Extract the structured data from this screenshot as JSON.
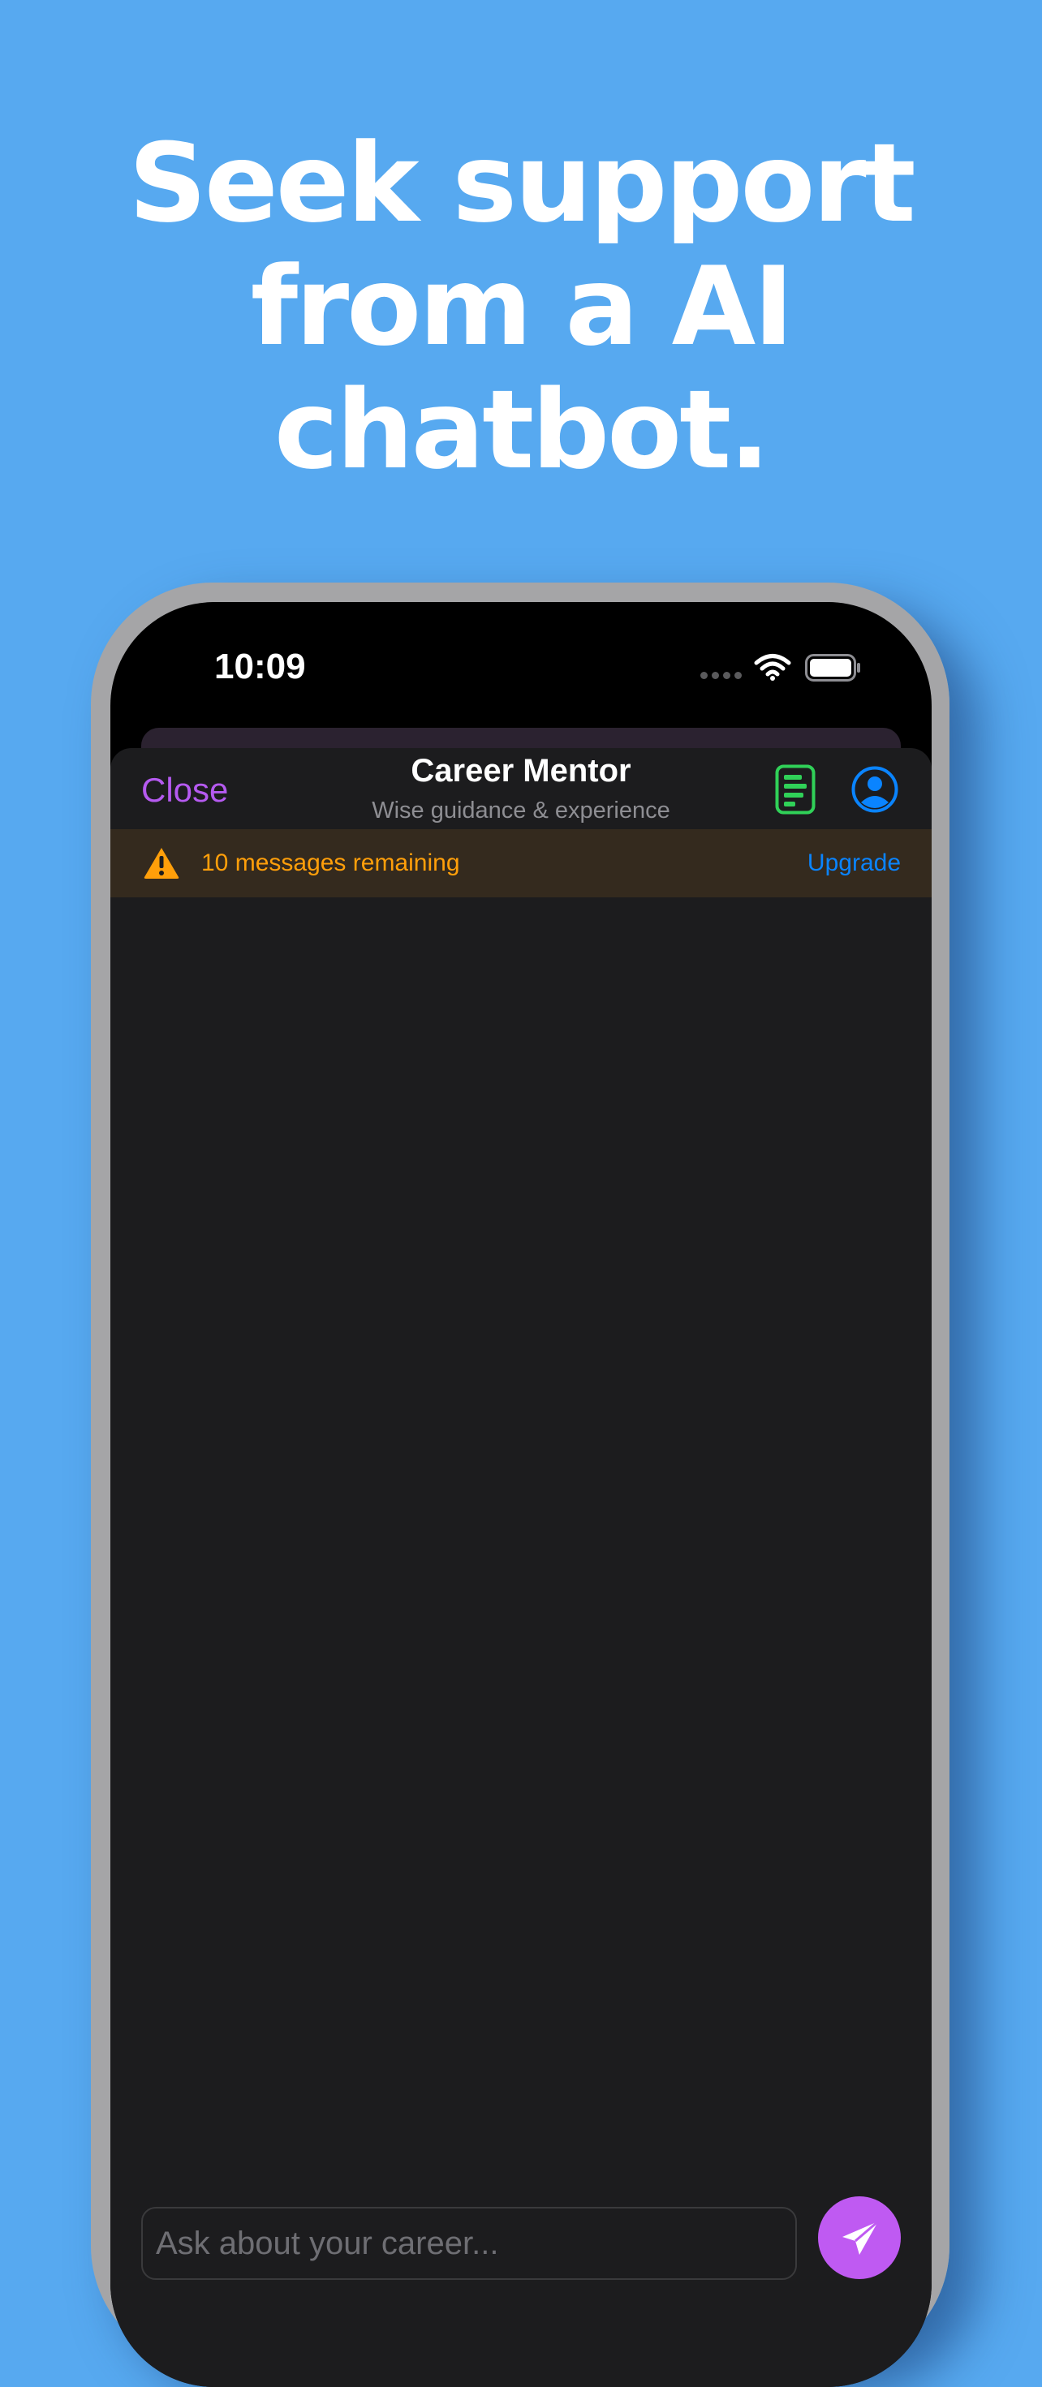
{
  "headline": {
    "lines": [
      "Seek support",
      "from a AI",
      "chatbot."
    ]
  },
  "status_bar": {
    "time": "10:09",
    "icons": [
      "signal-dots-icon",
      "wifi-icon",
      "battery-icon"
    ]
  },
  "nav": {
    "close_label": "Close",
    "title": "Career Mentor",
    "subtitle": "Wise guidance & experience",
    "icons": [
      "notes-icon",
      "profile-icon"
    ]
  },
  "banner": {
    "icon": "warning-icon",
    "text": "10 messages remaining",
    "action_label": "Upgrade"
  },
  "composer": {
    "placeholder": "Ask about your career...",
    "value": "",
    "send_icon": "send-icon"
  },
  "colors": {
    "background": "#57a9f0",
    "accent_purple": "#bf5af2",
    "warning_orange": "#ff9f0a",
    "link_blue": "#0a84ff",
    "notes_green": "#30d158",
    "sheet_background": "#1c1c1e"
  }
}
